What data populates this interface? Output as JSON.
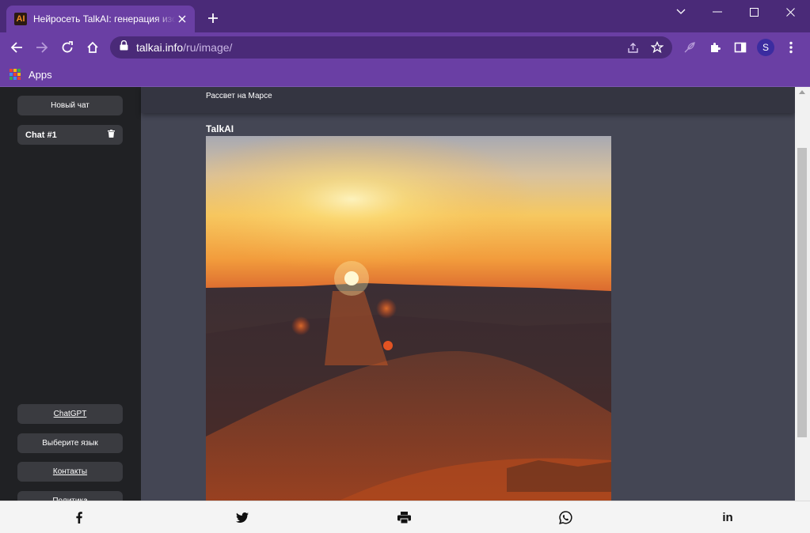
{
  "browser": {
    "tab_title": "Нейросеть TalkAI: генерация изображений",
    "tab_favicon_text": "AI",
    "url_host": "talkai.info",
    "url_path": "/ru/image/",
    "profile_initial": "S",
    "bookmarks": [
      {
        "label": "Apps"
      }
    ]
  },
  "sidebar": {
    "new_chat_label": "Новый чат",
    "chats": [
      {
        "label": "Chat #1"
      }
    ],
    "footer_buttons": [
      {
        "label": "ChatGPT"
      },
      {
        "label": "Выберите язык"
      },
      {
        "label": "Контакты"
      },
      {
        "label": "Политика"
      }
    ]
  },
  "main": {
    "prompt": "Рассвет на Марсе",
    "bot_name": "TalkAI"
  },
  "share": {
    "icons": [
      "facebook-icon",
      "twitter-icon",
      "print-icon",
      "whatsapp-icon",
      "linkedin-icon"
    ],
    "linkedin_text": "in"
  },
  "colors": {
    "chrome_dark": "#4a2a78",
    "chrome": "#6a3fa4",
    "sidebar": "#202124",
    "main": "#444654"
  }
}
